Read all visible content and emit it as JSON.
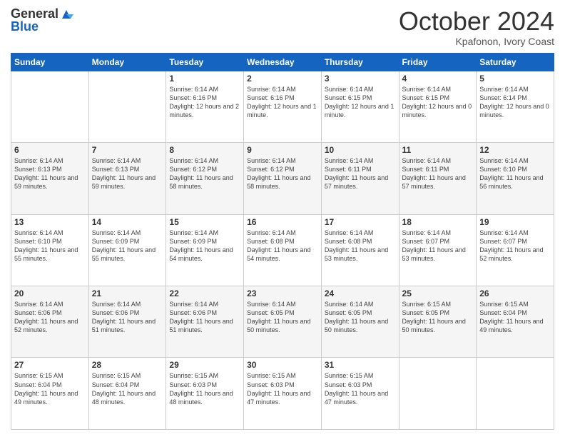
{
  "header": {
    "logo_general": "General",
    "logo_blue": "Blue",
    "month_title": "October 2024",
    "location": "Kpafonon, Ivory Coast"
  },
  "days_of_week": [
    "Sunday",
    "Monday",
    "Tuesday",
    "Wednesday",
    "Thursday",
    "Friday",
    "Saturday"
  ],
  "weeks": [
    [
      {
        "day": "",
        "content": ""
      },
      {
        "day": "",
        "content": ""
      },
      {
        "day": "1",
        "content": "Sunrise: 6:14 AM\nSunset: 6:16 PM\nDaylight: 12 hours and 2 minutes."
      },
      {
        "day": "2",
        "content": "Sunrise: 6:14 AM\nSunset: 6:16 PM\nDaylight: 12 hours and 1 minute."
      },
      {
        "day": "3",
        "content": "Sunrise: 6:14 AM\nSunset: 6:15 PM\nDaylight: 12 hours and 1 minute."
      },
      {
        "day": "4",
        "content": "Sunrise: 6:14 AM\nSunset: 6:15 PM\nDaylight: 12 hours and 0 minutes."
      },
      {
        "day": "5",
        "content": "Sunrise: 6:14 AM\nSunset: 6:14 PM\nDaylight: 12 hours and 0 minutes."
      }
    ],
    [
      {
        "day": "6",
        "content": "Sunrise: 6:14 AM\nSunset: 6:13 PM\nDaylight: 11 hours and 59 minutes."
      },
      {
        "day": "7",
        "content": "Sunrise: 6:14 AM\nSunset: 6:13 PM\nDaylight: 11 hours and 59 minutes."
      },
      {
        "day": "8",
        "content": "Sunrise: 6:14 AM\nSunset: 6:12 PM\nDaylight: 11 hours and 58 minutes."
      },
      {
        "day": "9",
        "content": "Sunrise: 6:14 AM\nSunset: 6:12 PM\nDaylight: 11 hours and 58 minutes."
      },
      {
        "day": "10",
        "content": "Sunrise: 6:14 AM\nSunset: 6:11 PM\nDaylight: 11 hours and 57 minutes."
      },
      {
        "day": "11",
        "content": "Sunrise: 6:14 AM\nSunset: 6:11 PM\nDaylight: 11 hours and 57 minutes."
      },
      {
        "day": "12",
        "content": "Sunrise: 6:14 AM\nSunset: 6:10 PM\nDaylight: 11 hours and 56 minutes."
      }
    ],
    [
      {
        "day": "13",
        "content": "Sunrise: 6:14 AM\nSunset: 6:10 PM\nDaylight: 11 hours and 55 minutes."
      },
      {
        "day": "14",
        "content": "Sunrise: 6:14 AM\nSunset: 6:09 PM\nDaylight: 11 hours and 55 minutes."
      },
      {
        "day": "15",
        "content": "Sunrise: 6:14 AM\nSunset: 6:09 PM\nDaylight: 11 hours and 54 minutes."
      },
      {
        "day": "16",
        "content": "Sunrise: 6:14 AM\nSunset: 6:08 PM\nDaylight: 11 hours and 54 minutes."
      },
      {
        "day": "17",
        "content": "Sunrise: 6:14 AM\nSunset: 6:08 PM\nDaylight: 11 hours and 53 minutes."
      },
      {
        "day": "18",
        "content": "Sunrise: 6:14 AM\nSunset: 6:07 PM\nDaylight: 11 hours and 53 minutes."
      },
      {
        "day": "19",
        "content": "Sunrise: 6:14 AM\nSunset: 6:07 PM\nDaylight: 11 hours and 52 minutes."
      }
    ],
    [
      {
        "day": "20",
        "content": "Sunrise: 6:14 AM\nSunset: 6:06 PM\nDaylight: 11 hours and 52 minutes."
      },
      {
        "day": "21",
        "content": "Sunrise: 6:14 AM\nSunset: 6:06 PM\nDaylight: 11 hours and 51 minutes."
      },
      {
        "day": "22",
        "content": "Sunrise: 6:14 AM\nSunset: 6:06 PM\nDaylight: 11 hours and 51 minutes."
      },
      {
        "day": "23",
        "content": "Sunrise: 6:14 AM\nSunset: 6:05 PM\nDaylight: 11 hours and 50 minutes."
      },
      {
        "day": "24",
        "content": "Sunrise: 6:14 AM\nSunset: 6:05 PM\nDaylight: 11 hours and 50 minutes."
      },
      {
        "day": "25",
        "content": "Sunrise: 6:15 AM\nSunset: 6:05 PM\nDaylight: 11 hours and 50 minutes."
      },
      {
        "day": "26",
        "content": "Sunrise: 6:15 AM\nSunset: 6:04 PM\nDaylight: 11 hours and 49 minutes."
      }
    ],
    [
      {
        "day": "27",
        "content": "Sunrise: 6:15 AM\nSunset: 6:04 PM\nDaylight: 11 hours and 49 minutes."
      },
      {
        "day": "28",
        "content": "Sunrise: 6:15 AM\nSunset: 6:04 PM\nDaylight: 11 hours and 48 minutes."
      },
      {
        "day": "29",
        "content": "Sunrise: 6:15 AM\nSunset: 6:03 PM\nDaylight: 11 hours and 48 minutes."
      },
      {
        "day": "30",
        "content": "Sunrise: 6:15 AM\nSunset: 6:03 PM\nDaylight: 11 hours and 47 minutes."
      },
      {
        "day": "31",
        "content": "Sunrise: 6:15 AM\nSunset: 6:03 PM\nDaylight: 11 hours and 47 minutes."
      },
      {
        "day": "",
        "content": ""
      },
      {
        "day": "",
        "content": ""
      }
    ]
  ]
}
